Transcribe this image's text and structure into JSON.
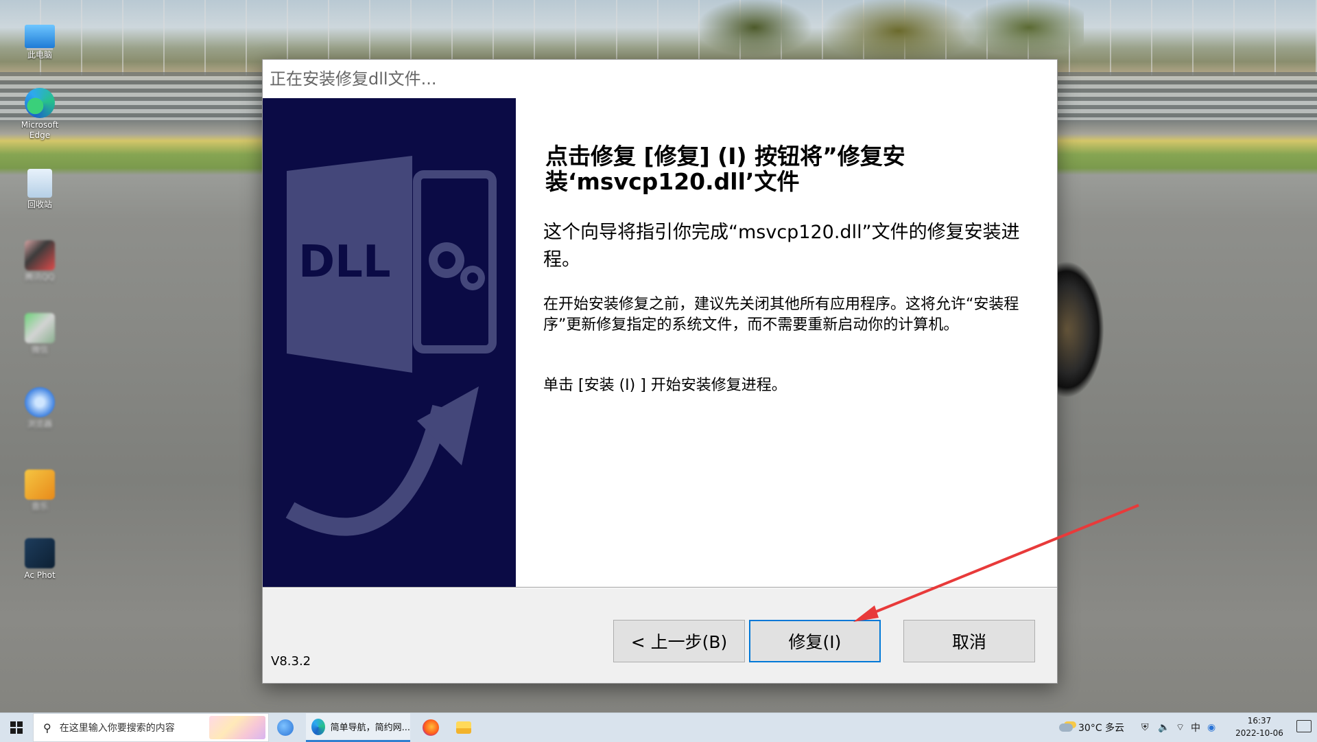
{
  "desktop": {
    "icons": [
      {
        "label": "此电脑"
      },
      {
        "label": "Microsoft Edge"
      },
      {
        "label": "回收站"
      },
      {
        "label": "腾讯QQ"
      },
      {
        "label": "微信"
      },
      {
        "label": "浏览器"
      },
      {
        "label": "音乐"
      },
      {
        "label": "Ac Phot"
      }
    ]
  },
  "dialog": {
    "title": "正在安装修复dll文件...",
    "banner": {
      "text": "DLL",
      "background": "#0b0b45"
    },
    "heading": "点击修复 [修复] (I) 按钮将”修复安装‘msvcp120.dll’文件",
    "subheading": "这个向导将指引你完成“msvcp120.dll”文件的修复安装进程。",
    "body": "在开始安装修复之前，建议先关闭其他所有应用程序。这将允许“安装程序”更新修复指定的系统文件，而不需要重新启动你的计算机。",
    "instruction": "单击 [安装 (I) ] 开始安装修复进程。",
    "version": "V8.3.2",
    "buttons": {
      "back": "< 上一步(B)",
      "repair": "修复(I)",
      "cancel": "取消"
    },
    "annotation_color": "#e83a3a"
  },
  "taskbar": {
    "search_placeholder": "在这里输入你要搜索的内容",
    "apps": [
      {
        "name": "sogou-browser"
      },
      {
        "name": "edge",
        "label": "简单导航，简约网..."
      },
      {
        "name": "firefox"
      },
      {
        "name": "file-explorer"
      }
    ],
    "weather": "30°C 多云",
    "input_method": "中",
    "time": "16:37",
    "date": "2022-10-06"
  }
}
